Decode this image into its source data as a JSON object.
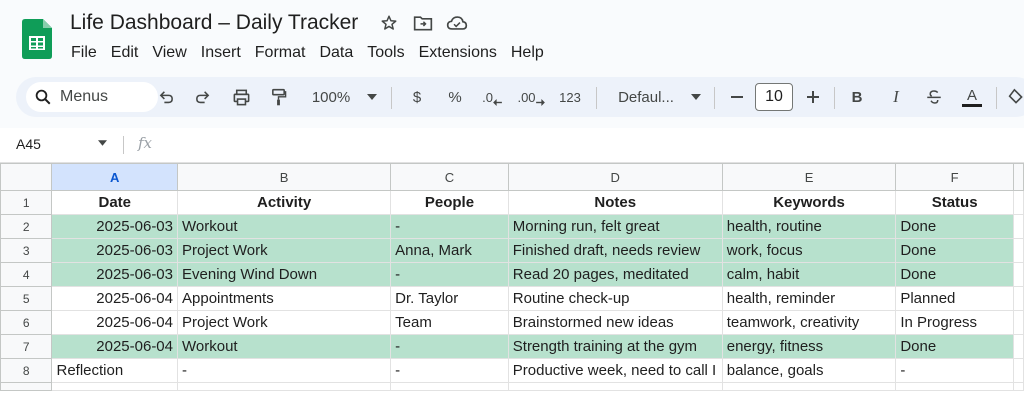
{
  "app": {
    "title": "Life Dashboard – Daily Tracker",
    "menu": [
      "File",
      "Edit",
      "View",
      "Insert",
      "Format",
      "Data",
      "Tools",
      "Extensions",
      "Help"
    ]
  },
  "toolbar": {
    "search_label": "Menus",
    "zoom": "100%",
    "currency": "$",
    "percent": "%",
    "decrease_decimal": ".0",
    "increase_decimal": ".00",
    "number_format": "123",
    "font": "Defaul...",
    "font_size": "10",
    "bold": "B",
    "italic": "I",
    "text_color": "A"
  },
  "formula_bar": {
    "cell_ref": "A45",
    "fx": "fx",
    "value": ""
  },
  "grid": {
    "columns": [
      "A",
      "B",
      "C",
      "D",
      "E",
      "F"
    ],
    "selected_column": "A",
    "headers": [
      "Date",
      "Activity",
      "People",
      "Notes",
      "Keywords",
      "Status"
    ],
    "highlight_color": "#b7e1cd",
    "rows": [
      {
        "n": "2",
        "hl": true,
        "cells": [
          "2025-06-03",
          "Workout",
          "-",
          "Morning run, felt great",
          "health, routine",
          "Done"
        ]
      },
      {
        "n": "3",
        "hl": true,
        "cells": [
          "2025-06-03",
          "Project Work",
          "Anna, Mark",
          "Finished draft, needs review",
          "work, focus",
          "Done"
        ]
      },
      {
        "n": "4",
        "hl": true,
        "cells": [
          "2025-06-03",
          "Evening Wind Down",
          "-",
          "Read 20 pages, meditated",
          "calm, habit",
          "Done"
        ]
      },
      {
        "n": "5",
        "hl": false,
        "cells": [
          "2025-06-04",
          "Appointments",
          "Dr. Taylor",
          "Routine check-up",
          "health, reminder",
          "Planned"
        ]
      },
      {
        "n": "6",
        "hl": false,
        "cells": [
          "2025-06-04",
          "Project Work",
          "Team",
          "Brainstormed new ideas",
          "teamwork, creativity",
          "In Progress"
        ]
      },
      {
        "n": "7",
        "hl": true,
        "cells": [
          "2025-06-04",
          "Workout",
          "-",
          "Strength training at the gym",
          "energy, fitness",
          "Done"
        ]
      },
      {
        "n": "8",
        "hl": false,
        "cells": [
          "Reflection",
          "-",
          "-",
          "Productive week, need to call I",
          "balance, goals",
          "-"
        ]
      }
    ]
  }
}
